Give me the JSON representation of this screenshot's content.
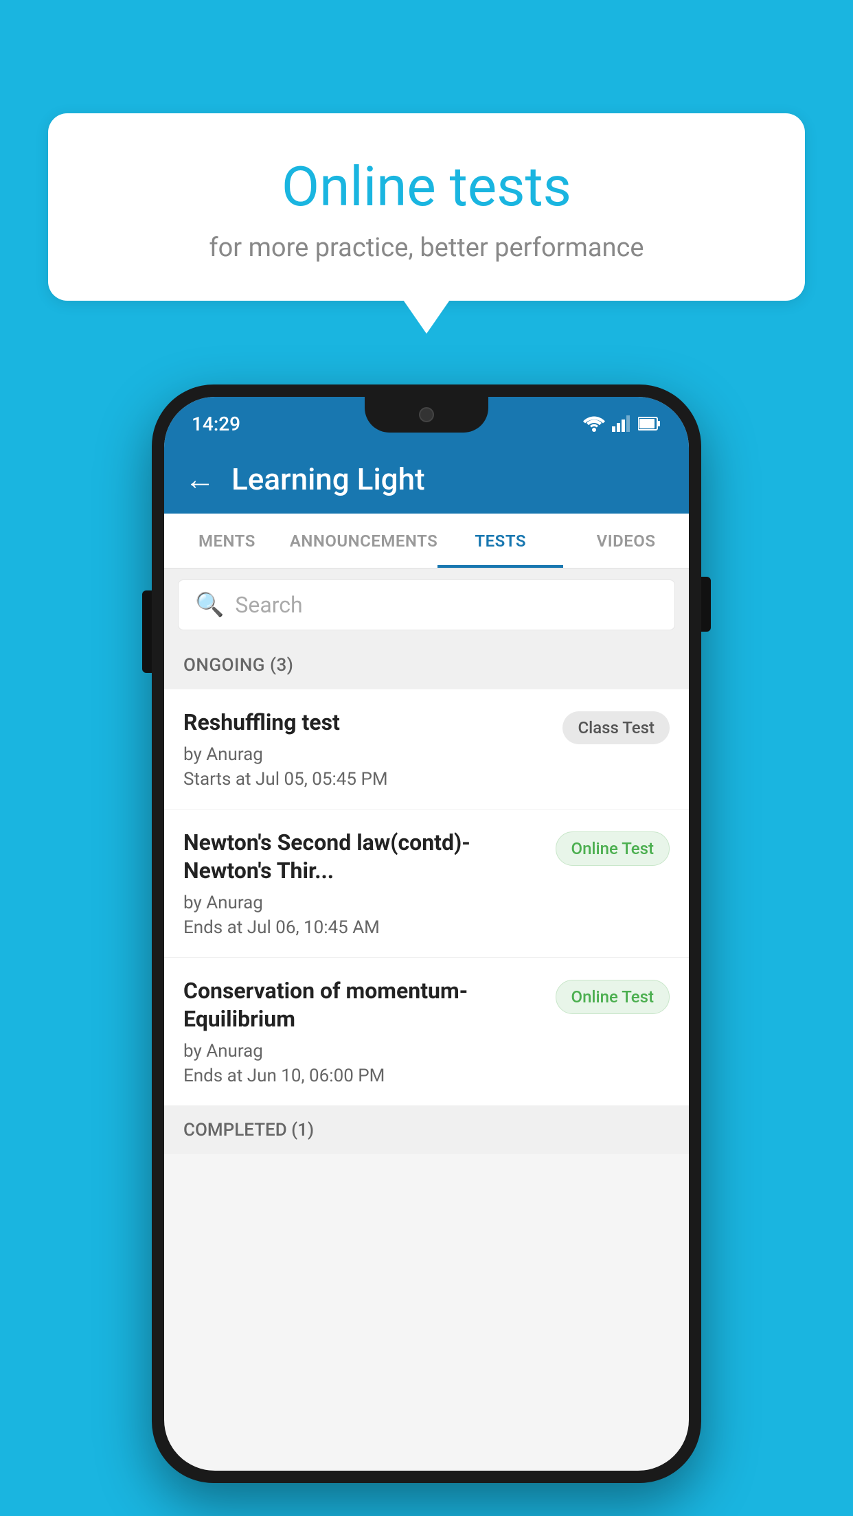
{
  "background_color": "#1ab5e0",
  "speech_bubble": {
    "title": "Online tests",
    "subtitle": "for more practice, better performance"
  },
  "phone": {
    "status_bar": {
      "time": "14:29",
      "icons": [
        "wifi",
        "signal",
        "battery"
      ]
    },
    "header": {
      "back_label": "←",
      "title": "Learning Light"
    },
    "tabs": [
      {
        "label": "MENTS",
        "active": false
      },
      {
        "label": "ANNOUNCEMENTS",
        "active": false
      },
      {
        "label": "TESTS",
        "active": true
      },
      {
        "label": "VIDEOS",
        "active": false
      }
    ],
    "search": {
      "placeholder": "Search"
    },
    "ongoing_section": {
      "title": "ONGOING (3)"
    },
    "tests": [
      {
        "name": "Reshuffling test",
        "author": "by Anurag",
        "date_label": "Starts at",
        "date": "Jul 05, 05:45 PM",
        "badge": "Class Test",
        "badge_type": "class"
      },
      {
        "name": "Newton's Second law(contd)-Newton's Thir...",
        "author": "by Anurag",
        "date_label": "Ends at",
        "date": "Jul 06, 10:45 AM",
        "badge": "Online Test",
        "badge_type": "online"
      },
      {
        "name": "Conservation of momentum-Equilibrium",
        "author": "by Anurag",
        "date_label": "Ends at",
        "date": "Jun 10, 06:00 PM",
        "badge": "Online Test",
        "badge_type": "online"
      }
    ],
    "completed_section": {
      "title": "COMPLETED (1)"
    }
  }
}
